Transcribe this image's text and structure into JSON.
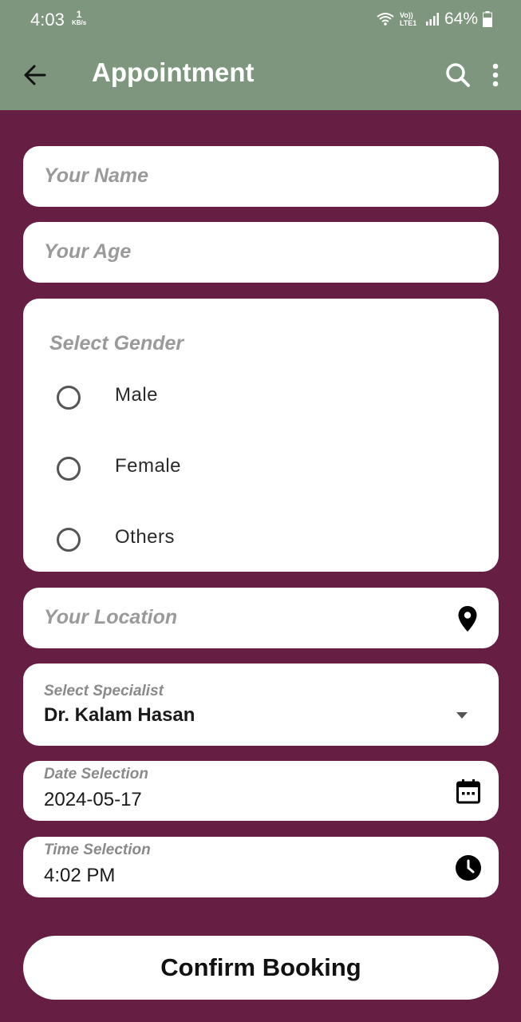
{
  "status_bar": {
    "time": "4:03",
    "speed_value": "1",
    "speed_unit": "KB/s",
    "network": "Vo)) LTE1",
    "battery": "64%"
  },
  "app_bar": {
    "title": "Appointment"
  },
  "form": {
    "name_placeholder": "Your Name",
    "age_placeholder": "Your Age",
    "gender": {
      "title": "Select Gender",
      "options": [
        "Male",
        "Female",
        "Others"
      ]
    },
    "location_placeholder": "Your Location",
    "specialist": {
      "label": "Select Specialist",
      "value": "Dr. Kalam Hasan"
    },
    "date": {
      "label": "Date Selection",
      "value": "2024-05-17"
    },
    "time": {
      "label": "Time Selection",
      "value": "4:02 PM"
    },
    "confirm_label": "Confirm Booking"
  }
}
